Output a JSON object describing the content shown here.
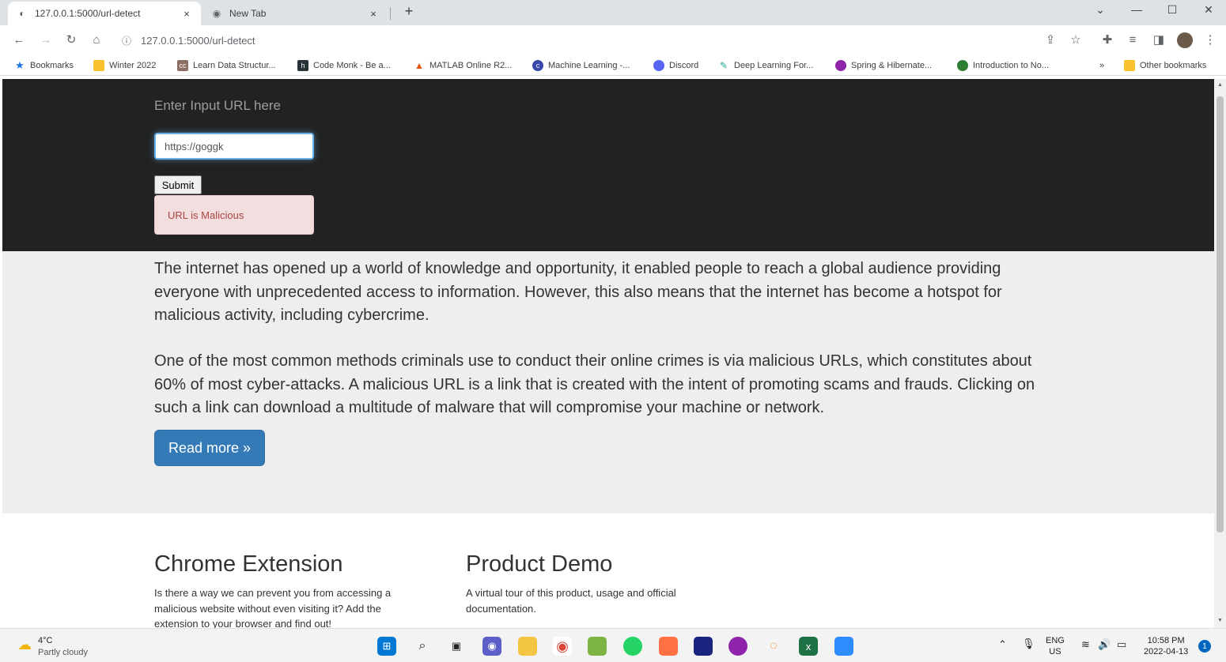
{
  "browser": {
    "tabs": [
      {
        "title": "127.0.0.1:5000/url-detect",
        "close": "×"
      },
      {
        "title": "New Tab",
        "close": "×"
      }
    ],
    "new_tab": "+",
    "window_controls": {
      "minimize": "—",
      "maximize": "☐",
      "close": "✕"
    },
    "address": "127.0.0.1:5000/url-detect",
    "bookmarks": [
      {
        "label": "Bookmarks",
        "color": "#1a73e8"
      },
      {
        "label": "Winter 2022",
        "color": "#fbc02d"
      },
      {
        "label": "Learn Data Structur...",
        "color": "#8d6e63"
      },
      {
        "label": "Code Monk - Be a...",
        "color": "#263238"
      },
      {
        "label": "MATLAB Online R2...",
        "color": "#e65100"
      },
      {
        "label": "Machine Learning -...",
        "color": "#3949ab"
      },
      {
        "label": "Discord",
        "color": "#5865f2"
      },
      {
        "label": "Deep Learning For...",
        "color": "#26a69a"
      },
      {
        "label": "Spring & Hibernate...",
        "color": "#8e24aa"
      },
      {
        "label": "Introduction to No...",
        "color": "#2e7d32"
      },
      {
        "label": "»",
        "color": ""
      },
      {
        "label": "Other bookmarks",
        "color": "#fbc02d"
      }
    ]
  },
  "header": {
    "prompt": "Enter Input URL here",
    "input_value": "https://goggk",
    "submit_label": "Submit",
    "result": "URL is Malicious"
  },
  "intro": {
    "paragraph1": "The internet has opened up a world of knowledge and opportunity, it enabled people to reach a global audience providing everyone with unprecedented access to information. However, this also means that the internet has become a hotspot for malicious activity, including cybercrime.",
    "paragraph2": "One of the most common methods criminals use to conduct their online crimes is via malicious URLs, which constitutes about 60% of most cyber-attacks. A malicious URL is a link that is created with the intent of promoting scams and frauds. Clicking on such a link can download a multitude of malware that will compromise your machine or network.",
    "read_more": "Read more »"
  },
  "columns": [
    {
      "title": "Chrome Extension",
      "text": "Is there a way we can prevent you from accessing a malicious website without even visiting it? Add the extension to your browser and find out!"
    },
    {
      "title": "Product Demo",
      "text": "A virtual tour of this product, usage and official documentation."
    }
  ],
  "taskbar": {
    "temperature": "4°C",
    "weather": "Partly cloudy",
    "language": "ENG",
    "region": "US",
    "time": "10:58 PM",
    "date": "2022-04-13",
    "notifications": "1"
  }
}
